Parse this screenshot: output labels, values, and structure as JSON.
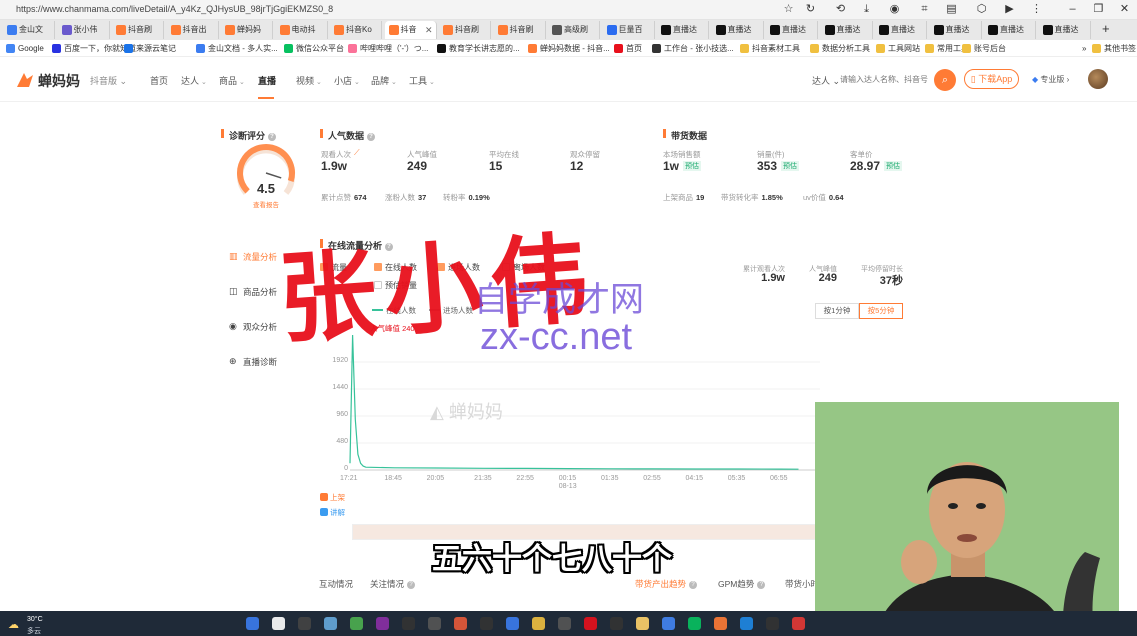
{
  "browser": {
    "url": "https://www.chanmama.com/liveDetail/A_y4Kz_QJHysUB_98jrTjGgiEKMZS0_8",
    "tabs": [
      {
        "label": "金山文",
        "color": "#3b7cf0"
      },
      {
        "label": "张小伟",
        "color": "#6a5acd"
      },
      {
        "label": "抖音刷",
        "color": "#ff7b35"
      },
      {
        "label": "抖音出",
        "color": "#ff7b35"
      },
      {
        "label": "蝉妈妈",
        "color": "#ff7b35"
      },
      {
        "label": "电动抖",
        "color": "#ff7b35"
      },
      {
        "label": "抖音Ko",
        "color": "#ff7b35"
      },
      {
        "label": "抖音",
        "color": "#ff7b35"
      },
      {
        "label": "抖音刷",
        "color": "#ff7b35"
      },
      {
        "label": "抖音刷",
        "color": "#ff7b35"
      },
      {
        "label": "高级刷",
        "color": "#555"
      },
      {
        "label": "巨量百",
        "color": "#2b6cf0"
      },
      {
        "label": "直播达",
        "color": "#111"
      },
      {
        "label": "直播达",
        "color": "#111"
      },
      {
        "label": "直播达",
        "color": "#111"
      },
      {
        "label": "直播达",
        "color": "#111"
      },
      {
        "label": "直播达",
        "color": "#111"
      },
      {
        "label": "直播达",
        "color": "#111"
      },
      {
        "label": "直播达",
        "color": "#111"
      },
      {
        "label": "直播达",
        "color": "#111"
      }
    ],
    "bookmarks": [
      {
        "label": "Google",
        "color": "#4285f4"
      },
      {
        "label": "百度一下，你就知道",
        "color": "#2932e1"
      },
      {
        "label": "来源云笔记",
        "color": "#1a73e8"
      },
      {
        "label": "金山文档 - 多人实...",
        "color": "#3b7cf0"
      },
      {
        "label": "微信公众平台",
        "color": "#07c160"
      },
      {
        "label": "哔哩哔哩（'-'）つ...",
        "color": "#fb7299"
      },
      {
        "label": "教育学长讲志愿的...",
        "color": "#111"
      },
      {
        "label": "蝉妈妈数据 - 抖音...",
        "color": "#ff7b35"
      },
      {
        "label": "首页",
        "color": "#e8101c"
      },
      {
        "label": "工作台 - 张小技选...",
        "color": "#333"
      },
      {
        "label": "抖音素材工具",
        "color": "#f0c040"
      },
      {
        "label": "数据分析工具",
        "color": "#f0c040"
      },
      {
        "label": "工具网站",
        "color": "#f0c040"
      },
      {
        "label": "常用工具",
        "color": "#f0c040"
      },
      {
        "label": "账号后台",
        "color": "#f0c040"
      },
      {
        "label": "其他书签",
        "color": "#f0c040"
      }
    ],
    "more_bookmarks": "»"
  },
  "site": {
    "logo": "蝉妈妈",
    "platform": "抖音版",
    "nav": [
      "首页",
      "达人",
      "商品",
      "直播",
      "视频",
      "小店",
      "品牌",
      "工具"
    ],
    "active_nav": "直播",
    "search_scope": "达人",
    "search_placeholder": "请输入达人名称、抖音号",
    "download": "下载App",
    "vip": "专业版"
  },
  "diagnosis": {
    "title": "诊断评分",
    "score": "4.5",
    "link": "查看报告",
    "score_fraction": 0.9
  },
  "popularity": {
    "title": "人气数据",
    "metrics": [
      {
        "label": "观看人次",
        "value": "1.9w"
      },
      {
        "label": "人气峰值",
        "value": "249"
      },
      {
        "label": "平均在线",
        "value": "15"
      },
      {
        "label": "观众停留",
        "value": "12"
      }
    ],
    "stats": [
      {
        "label": "累计点赞",
        "value": "674"
      },
      {
        "label": "涨粉人数",
        "value": "37"
      },
      {
        "label": "转粉率",
        "value": "0.19%"
      }
    ]
  },
  "sales": {
    "title": "带货数据",
    "metrics": [
      {
        "label": "本场销售额",
        "value": "1w",
        "badge": "预估"
      },
      {
        "label": "销量(件)",
        "value": "353",
        "badge": "预估"
      },
      {
        "label": "客单价",
        "value": "28.97",
        "badge": "预估"
      }
    ],
    "stats": [
      {
        "label": "上架商品",
        "value": "19"
      },
      {
        "label": "带货转化率",
        "value": "1.85%"
      },
      {
        "label": "uv价值",
        "value": "0.64"
      }
    ]
  },
  "side_menu": [
    {
      "label": "流量分析",
      "icon": "chart-icon"
    },
    {
      "label": "商品分析",
      "icon": "bag-icon"
    },
    {
      "label": "观众分析",
      "icon": "eye-icon"
    },
    {
      "label": "直播诊断",
      "icon": "plus-circle-icon"
    }
  ],
  "traffic": {
    "title": "在线流量分析",
    "checkboxes": [
      {
        "label": "流量",
        "on": true
      },
      {
        "label": "在线人数",
        "on": true
      },
      {
        "label": "进场人数",
        "on": true
      },
      {
        "label": "离场人数",
        "on": false
      },
      {
        "label": "预估销量",
        "on": false
      }
    ],
    "legend": [
      {
        "label": "在线人数",
        "color": "#37c29a"
      },
      {
        "label": "进场人数",
        "color": "#9aa0a6"
      }
    ],
    "peak_label": "人气峰值",
    "peak_value": "240",
    "summary": [
      {
        "label": "累计观看人次",
        "value": "1.9w"
      },
      {
        "label": "人气峰值",
        "value": "249"
      },
      {
        "label": "平均停留时长",
        "value": "37秒"
      }
    ],
    "intervals": [
      "按1分钟",
      "按5分钟"
    ],
    "active_interval": "按5分钟",
    "chart_watermark": "蝉妈妈",
    "product_rows": [
      "上架",
      "讲解"
    ]
  },
  "chart_data": {
    "type": "line",
    "title": "",
    "ylim": [
      0,
      2400
    ],
    "yticks": [
      0,
      480,
      960,
      1440,
      1920
    ],
    "xticks": [
      "17:21",
      "18:45",
      "20:05",
      "21:35",
      "22:55",
      "00:15",
      "01:35",
      "02:55",
      "04:15",
      "05:35",
      "06:55"
    ],
    "xticks_sub": {
      "00:15": "08-13"
    },
    "series": [
      {
        "name": "在线人数",
        "x": [
          "17:21",
          "17:26",
          "17:31",
          "17:36",
          "17:41",
          "17:46",
          "17:51",
          "18:45",
          "20:05",
          "21:35",
          "22:55",
          "00:15",
          "01:35",
          "02:55",
          "04:15",
          "05:35",
          "06:55",
          "07:30"
        ],
        "values": [
          120,
          2400,
          900,
          280,
          120,
          70,
          50,
          40,
          35,
          30,
          28,
          25,
          22,
          20,
          18,
          18,
          16,
          15
        ]
      }
    ]
  },
  "overlay": {
    "handwriting": "张小伟",
    "site_watermark_cn": "自学成才网",
    "site_watermark_url": "zx-cc.net",
    "subtitle": "五六十个七八十个"
  },
  "bottom_tabs": [
    "互动情况",
    "关注情况",
    "带货产出趋势",
    "GPM趋势",
    "带货小时"
  ],
  "active_bottom_tab": "带货产出趋势",
  "taskbar": {
    "temp": "30°C",
    "weather": "多云"
  }
}
